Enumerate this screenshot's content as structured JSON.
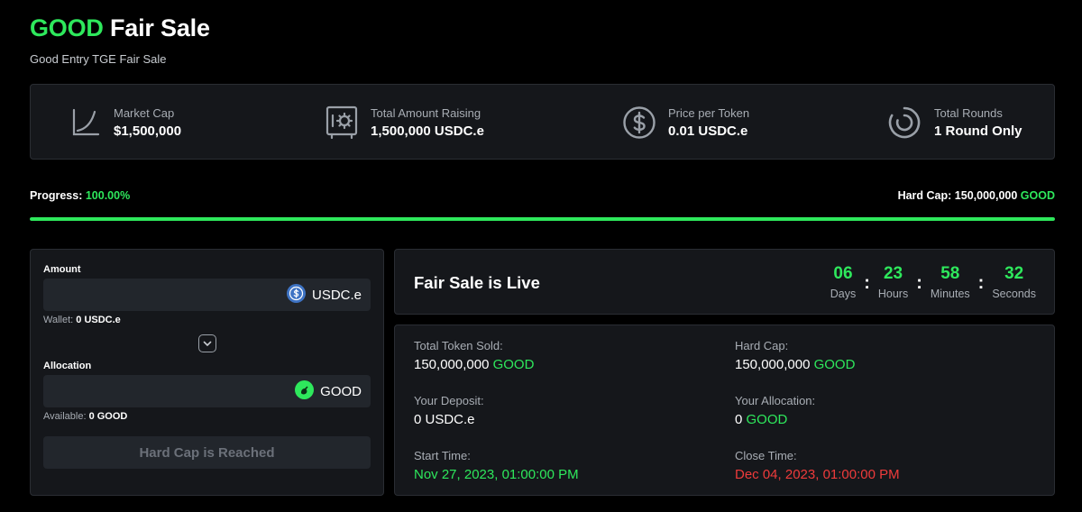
{
  "header": {
    "title_highlight": "GOOD",
    "title_rest": "Fair Sale",
    "subtitle": "Good Entry TGE Fair Sale"
  },
  "stats": [
    {
      "icon": "chart-curve-icon",
      "label": "Market Cap",
      "value": "$1,500,000"
    },
    {
      "icon": "safe-icon",
      "label": "Total Amount Raising",
      "value": "1,500,000 USDC.e"
    },
    {
      "icon": "dollar-coin-icon",
      "label": "Price per Token",
      "value": "0.01 USDC.e"
    },
    {
      "icon": "rounds-icon",
      "label": "Total Rounds",
      "value": "1 Round Only"
    }
  ],
  "progress": {
    "label": "Progress:",
    "percent_text": "100.00%",
    "fill_percent": 100,
    "hard_cap_label": "Hard Cap:",
    "hard_cap_value": "150,000,000",
    "hard_cap_token": "GOOD"
  },
  "form": {
    "amount_label": "Amount",
    "amount_value": "",
    "amount_token": "USDC.e",
    "wallet_label": "Wallet:",
    "wallet_value": "0 USDC.e",
    "allocation_label": "Allocation",
    "allocation_value": "",
    "allocation_token": "GOOD",
    "available_label": "Available:",
    "available_value": "0 GOOD",
    "button_label": "Hard Cap is Reached"
  },
  "countdown": {
    "title": "Fair Sale is Live",
    "days": "06",
    "days_label": "Days",
    "hours": "23",
    "hours_label": "Hours",
    "minutes": "58",
    "minutes_label": "Minutes",
    "seconds": "32",
    "seconds_label": "Seconds",
    "separator": ":"
  },
  "info": {
    "total_sold_label": "Total Token Sold:",
    "total_sold_value": "150,000,000",
    "total_sold_token": "GOOD",
    "hard_cap_label": "Hard Cap:",
    "hard_cap_value": "150,000,000",
    "hard_cap_token": "GOOD",
    "deposit_label": "Your Deposit:",
    "deposit_value": "0 USDC.e",
    "allocation_label": "Your Allocation:",
    "allocation_value": "0",
    "allocation_token": "GOOD",
    "start_label": "Start Time:",
    "start_value": "Nov 27, 2023, 01:00:00 PM",
    "close_label": "Close Time:",
    "close_value": "Dec 04, 2023, 01:00:00 PM"
  },
  "colors": {
    "accent_green": "#2ee85c",
    "close_red": "#ef3b3b",
    "panel_bg": "#15171b",
    "usdc_blue": "#3e73c4"
  }
}
